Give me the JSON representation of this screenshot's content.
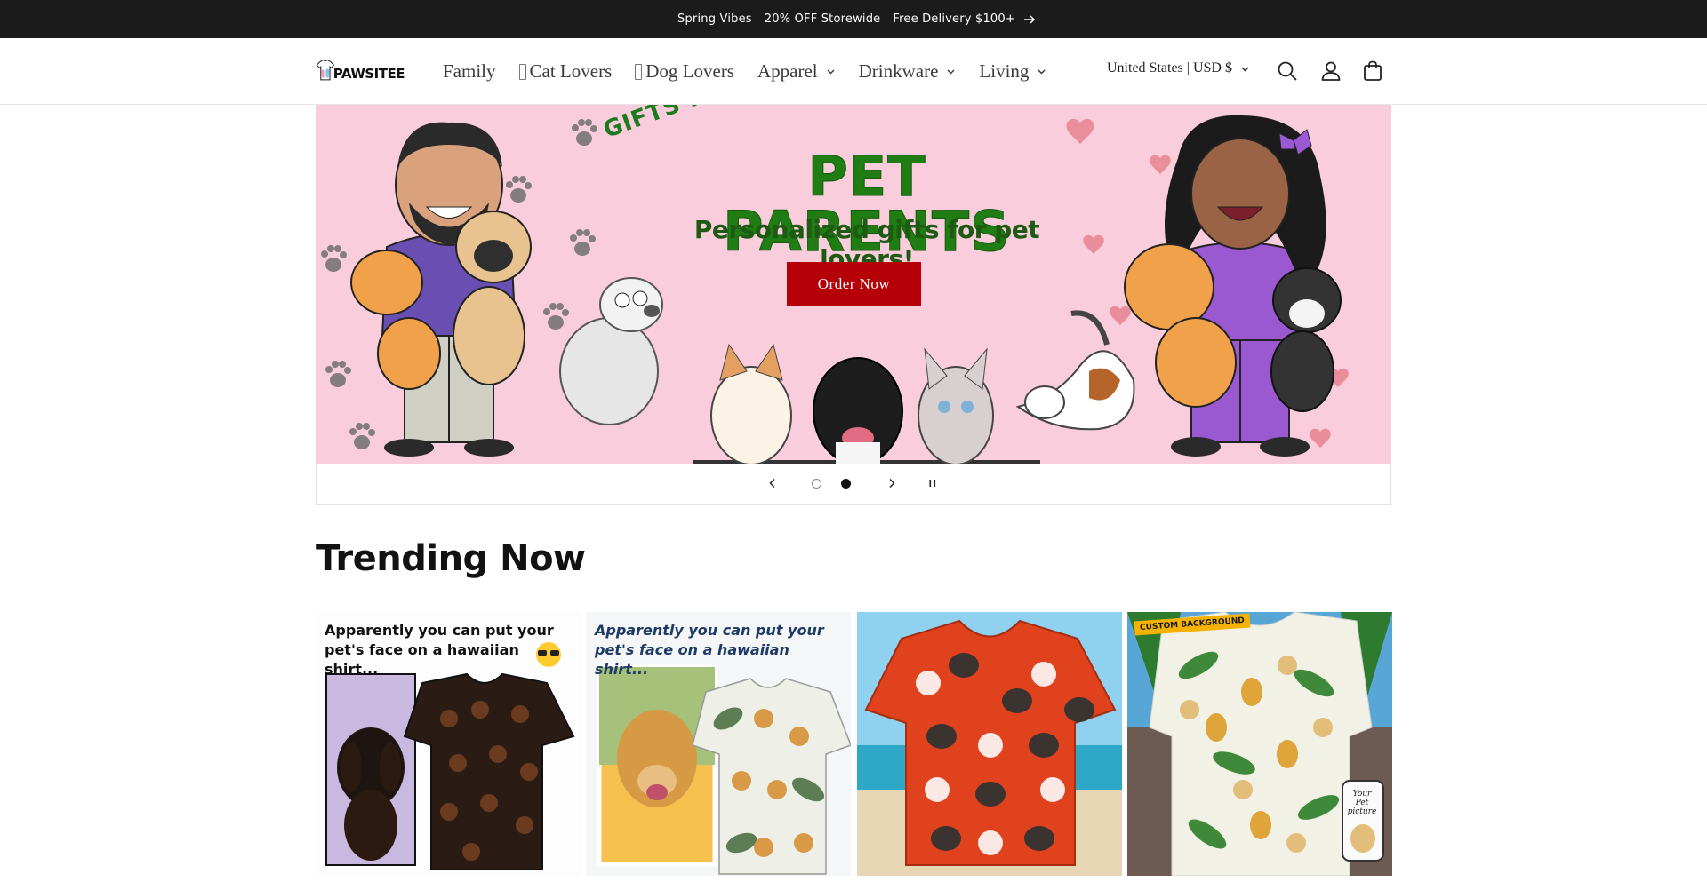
{
  "announcement": {
    "items": [
      "Spring Vibes",
      "20% OFF Storewide",
      "Free Delivery $100+"
    ],
    "arrow_icon": "arrow-right-icon"
  },
  "header": {
    "logo_text": "PAWSITEE",
    "nav": [
      {
        "label": "Family",
        "has_dropdown": false,
        "icon": null
      },
      {
        "label": "Cat Lovers",
        "has_dropdown": false,
        "icon": "missing-glyph-icon"
      },
      {
        "label": "Dog Lovers",
        "has_dropdown": false,
        "icon": "missing-glyph-icon"
      },
      {
        "label": "Apparel",
        "has_dropdown": true
      },
      {
        "label": "Drinkware",
        "has_dropdown": true
      },
      {
        "label": "Living",
        "has_dropdown": true
      }
    ],
    "currency": "United States | USD $",
    "icons": [
      "search-icon",
      "account-icon",
      "cart-icon"
    ]
  },
  "hero": {
    "title_small": "GIFTS FOR",
    "title": "PET PARENTS",
    "subtitle": "Personalized gifts for pet lovers!",
    "cta": "Order Now",
    "background_color": "#f9cddb",
    "cta_color": "#b40006",
    "title_color": "#1f7d14",
    "slides_total": 2,
    "slide_active": 2
  },
  "trending": {
    "title": "Trending Now",
    "products": [
      {
        "caption": "Apparently you can put your pet's face on a hawaiian shirt..."
      },
      {
        "caption": "Apparently you can put your pet's face on a hawaiian shirt..."
      },
      {
        "caption": ""
      },
      {
        "badge": "CUSTOM BACKGROUND",
        "phone_label": "Your Pet picture"
      }
    ]
  }
}
